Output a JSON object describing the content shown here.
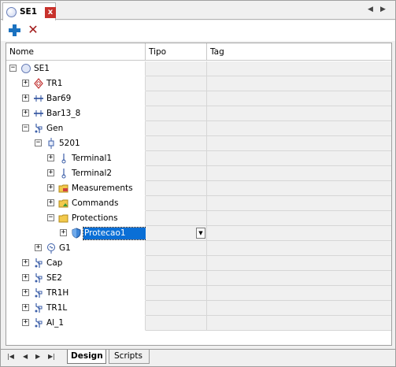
{
  "document_tab": {
    "title": "SE1",
    "close_label": "x"
  },
  "tab_nav": {
    "prev": "◀",
    "next": "▶"
  },
  "toolbar": {
    "add_label": "+",
    "delete_label": "✕"
  },
  "grid": {
    "columns": [
      "Nome",
      "Tipo",
      "Tag"
    ],
    "rows": [
      {
        "label": "SE1",
        "icon": "substation-icon",
        "level": 0,
        "expander": "−"
      },
      {
        "label": "TR1",
        "icon": "transformer-icon",
        "level": 1,
        "expander": "+"
      },
      {
        "label": "Bar69",
        "icon": "busbar-icon",
        "level": 1,
        "expander": "+"
      },
      {
        "label": "Bar13_8",
        "icon": "busbar-icon",
        "level": 1,
        "expander": "+"
      },
      {
        "label": "Gen",
        "icon": "bay-icon",
        "level": 1,
        "expander": "−"
      },
      {
        "label": "5201",
        "icon": "breaker-icon",
        "level": 2,
        "expander": "−"
      },
      {
        "label": "Terminal1",
        "icon": "terminal-icon",
        "level": 3,
        "expander": "+"
      },
      {
        "label": "Terminal2",
        "icon": "terminal-icon",
        "level": 3,
        "expander": "+"
      },
      {
        "label": "Measurements",
        "icon": "measurements-folder-icon",
        "level": 3,
        "expander": "+"
      },
      {
        "label": "Commands",
        "icon": "commands-folder-icon",
        "level": 3,
        "expander": "+"
      },
      {
        "label": "Protections",
        "icon": "protections-folder-icon",
        "level": 3,
        "expander": "−"
      },
      {
        "label": "Protecao1",
        "icon": "shield-icon",
        "level": 4,
        "expander": "+",
        "selected": true
      },
      {
        "label": "G1",
        "icon": "generator-icon",
        "level": 2,
        "expander": "+"
      },
      {
        "label": "Cap",
        "icon": "bay-icon",
        "level": 1,
        "expander": "+"
      },
      {
        "label": "SE2",
        "icon": "bay-icon",
        "level": 1,
        "expander": "+"
      },
      {
        "label": "TR1H",
        "icon": "bay-icon",
        "level": 1,
        "expander": "+"
      },
      {
        "label": "TR1L",
        "icon": "bay-icon",
        "level": 1,
        "expander": "+"
      },
      {
        "label": "Al_1",
        "icon": "bay-icon",
        "level": 1,
        "expander": "+"
      }
    ]
  },
  "bottom_tabs": {
    "design": "Design",
    "scripts": "Scripts"
  },
  "colors": {
    "selection": "#0a6fd6",
    "accent_blue": "#1b72c0",
    "delete_red": "#a11a1a",
    "close_red": "#c8322c"
  }
}
